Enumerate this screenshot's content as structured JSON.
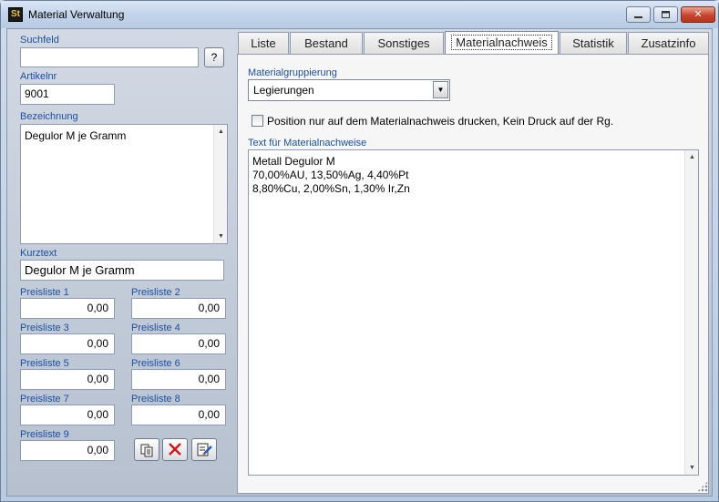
{
  "window": {
    "title": "Material Verwaltung",
    "close_glyph": "✕",
    "icon_letter": "St"
  },
  "left": {
    "suchfeld_label": "Suchfeld",
    "suchfeld_value": "",
    "search_button": "?",
    "artikelnr_label": "Artikelnr",
    "artikelnr_value": "9001",
    "bezeichnung_label": "Bezeichnung",
    "bezeichnung_value": "Degulor M je Gramm",
    "kurztext_label": "Kurztext",
    "kurztext_value": "Degulor M je Gramm",
    "preislisten": [
      {
        "label": "Preisliste 1",
        "value": "0,00"
      },
      {
        "label": "Preisliste 2",
        "value": "0,00"
      },
      {
        "label": "Preisliste 3",
        "value": "0,00"
      },
      {
        "label": "Preisliste 4",
        "value": "0,00"
      },
      {
        "label": "Preisliste 5",
        "value": "0,00"
      },
      {
        "label": "Preisliste 6",
        "value": "0,00"
      },
      {
        "label": "Preisliste 7",
        "value": "0,00"
      },
      {
        "label": "Preisliste 8",
        "value": "0,00"
      },
      {
        "label": "Preisliste 9",
        "value": "0,00"
      }
    ],
    "action_icons": [
      "copy-icon",
      "delete-icon",
      "edit-icon"
    ]
  },
  "tabs": [
    {
      "label": "Liste"
    },
    {
      "label": "Bestand"
    },
    {
      "label": "Sonstiges"
    },
    {
      "label": "Materialnachweis",
      "active": true
    },
    {
      "label": "Statistik"
    },
    {
      "label": "Zusatzinfo"
    }
  ],
  "materialnachweis": {
    "gruppierung_label": "Materialgruppierung",
    "gruppierung_value": "Legierungen",
    "checkbox_label": "Position nur auf dem Materialnachweis drucken, Kein Druck auf der Rg.",
    "checkbox_checked": false,
    "text_label": "Text für Materialnachweise",
    "text_lines": [
      "Metall Degulor M",
      "70,00%AU, 13,50%Ag, 4,40%Pt",
      "8,80%Cu, 2,00%Sn, 1,30% Ir,Zn"
    ]
  },
  "colors": {
    "label_blue": "#1d4fa0",
    "close_red": "#c9442c"
  }
}
